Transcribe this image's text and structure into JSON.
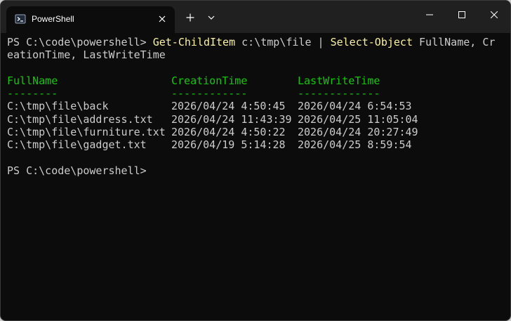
{
  "window": {
    "tab_title": "PowerShell",
    "tab_icon": "powershell-icon",
    "new_tab_icon": "plus-icon",
    "dropdown_icon": "chevron-down-icon",
    "minimize_icon": "minimize-icon",
    "maximize_icon": "maximize-icon",
    "close_icon": "close-icon"
  },
  "colors": {
    "background": "#0c0c0c",
    "titlebar": "#202020",
    "text": "#cccccc",
    "command": "#f9f1a5",
    "header": "#16c60c"
  },
  "terminal": {
    "command_line": {
      "prompt": "PS C:\\code\\powershell> ",
      "cmd1": "Get-ChildItem",
      "arg1": " c:\\tmp\\file ",
      "pipe": "|",
      "cmd2_pre": " ",
      "cmd2": "Select-Object",
      "args2_line1": " FullName, Cr",
      "args2_line2": "eationTime, LastWriteTime"
    },
    "table": {
      "headers": [
        "FullName",
        "CreationTime",
        "LastWriteTime"
      ],
      "underlines": [
        "--------",
        "------------",
        "-------------"
      ],
      "rows": [
        [
          "C:\\tmp\\file\\back",
          "2026/04/24 4:50:45",
          "2026/04/24 6:54:53"
        ],
        [
          "C:\\tmp\\file\\address.txt",
          "2026/04/24 11:43:39",
          "2026/04/25 11:05:04"
        ],
        [
          "C:\\tmp\\file\\furniture.txt",
          "2026/04/24 4:50:22",
          "2026/04/24 20:27:49"
        ],
        [
          "C:\\tmp\\file\\gadget.txt",
          "2026/04/19 5:14:28",
          "2026/04/25 8:59:54"
        ]
      ]
    },
    "final_prompt": "PS C:\\code\\powershell>"
  }
}
